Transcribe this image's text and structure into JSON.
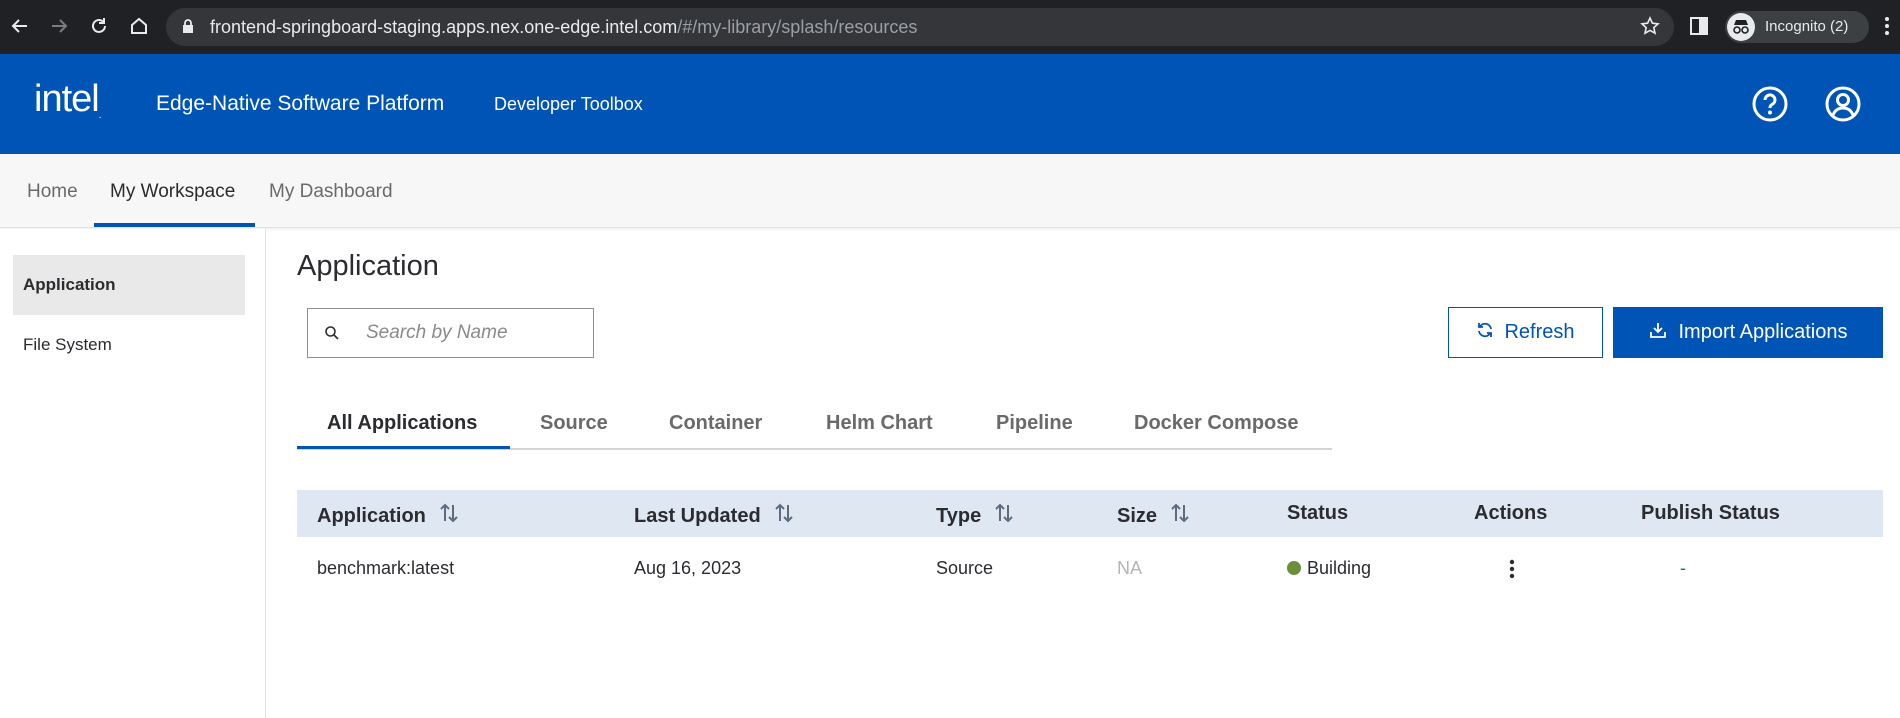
{
  "browser": {
    "url_host": "frontend-springboard-staging.apps.nex.one-edge.intel.com",
    "url_path": "/#/my-library/splash/resources",
    "profile_label": "Incognito (2)"
  },
  "header": {
    "logo": "intel",
    "platform_title": "Edge-Native Software Platform",
    "toolbox_link": "Developer Toolbox"
  },
  "subnav": {
    "tabs": [
      {
        "label": "Home"
      },
      {
        "label": "My Workspace"
      },
      {
        "label": "My Dashboard"
      }
    ],
    "active": "My Workspace"
  },
  "sidebar": {
    "items": [
      {
        "label": "Application"
      },
      {
        "label": "File System"
      }
    ]
  },
  "main": {
    "title": "Application",
    "search_placeholder": "Search by Name",
    "refresh_label": "Refresh",
    "import_label": "Import Applications",
    "tabs": [
      {
        "label": "All Applications"
      },
      {
        "label": "Source"
      },
      {
        "label": "Container"
      },
      {
        "label": "Helm Chart"
      },
      {
        "label": "Pipeline"
      },
      {
        "label": "Docker Compose"
      }
    ],
    "table": {
      "columns": [
        "Application",
        "Last Updated",
        "Type",
        "Size",
        "Status",
        "Actions",
        "Publish Status"
      ],
      "rows": [
        {
          "application": "benchmark:latest",
          "last_updated": "Aug 16, 2023",
          "type": "Source",
          "size": "NA",
          "status": "Building",
          "publish_status": "-"
        }
      ]
    }
  },
  "colors": {
    "brand": "#0054b6",
    "status_building": "#6b8e3a"
  }
}
